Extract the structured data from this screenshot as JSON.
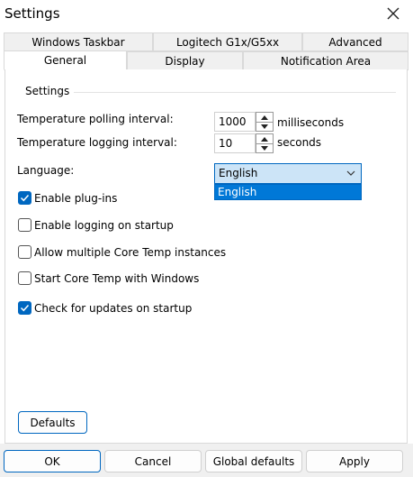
{
  "window": {
    "title": "Settings"
  },
  "tabs_row1": [
    "Windows Taskbar",
    "Logitech G1x/G5xx",
    "Advanced"
  ],
  "tabs_row2": [
    "General",
    "Display",
    "Notification Area"
  ],
  "active_tab": "General",
  "group": {
    "title": "Settings"
  },
  "polling": {
    "label": "Temperature polling interval:",
    "value": "1000",
    "unit": "milliseconds"
  },
  "logging": {
    "label": "Temperature logging interval:",
    "value": "10",
    "unit": "seconds"
  },
  "language": {
    "label": "Language:",
    "selected": "English",
    "options": [
      "English"
    ]
  },
  "checkboxes": [
    {
      "label": "Enable plug-ins",
      "checked": true
    },
    {
      "label": "Enable logging on startup",
      "checked": false
    },
    {
      "label": "Allow multiple Core Temp instances",
      "checked": false
    },
    {
      "label": "Start Core Temp with Windows",
      "checked": false
    },
    {
      "label": "Check for updates on startup",
      "checked": true
    }
  ],
  "buttons": {
    "defaults": "Defaults",
    "ok": "OK",
    "cancel": "Cancel",
    "global_defaults": "Global defaults",
    "apply": "Apply"
  },
  "colors": {
    "accent": "#0067c0",
    "selection": "#0078d7"
  }
}
